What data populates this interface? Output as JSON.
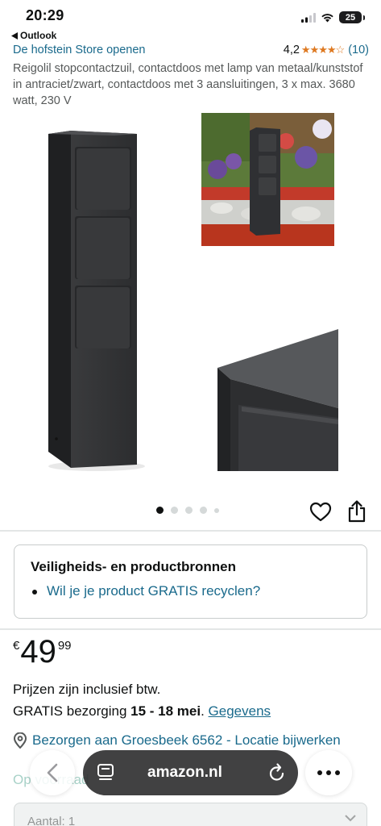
{
  "status_bar": {
    "time": "20:29",
    "battery": "25",
    "back_app": "Outlook"
  },
  "store": {
    "link": "De hofstein Store openen",
    "rating": "4,2",
    "stars": "★★★★☆",
    "review_count": "(10)"
  },
  "product": {
    "title": "Reigolil stopcontactzuil, contactdoos met lamp van metaal/kunststof in antraciet/zwart, contactdoos met 3 aansluitingen, 3 x max. 3680 watt, 230 V"
  },
  "gallery": {
    "dots_total": 5,
    "active_dot": 1
  },
  "safety": {
    "title": "Veiligheids- en productbronnen",
    "link": "Wil je je product GRATIS recyclen?"
  },
  "price": {
    "currency": "€",
    "whole": "49",
    "fraction": "99"
  },
  "vat": "Prijzen zijn inclusief btw.",
  "delivery": {
    "prefix": "GRATIS bezorging ",
    "dates": "15 - 18 mei",
    "separator": ". ",
    "link": "Gegevens"
  },
  "location": "Bezorgen aan Groesbeek 6562 - Locatie bijwerken",
  "stock": "Op voorraad",
  "quantity": "Aantal: 1",
  "browser": {
    "url": "amazon.nl"
  },
  "colors": {
    "link": "#1a6a8c",
    "star": "#de7921",
    "stock": "#067d62"
  }
}
